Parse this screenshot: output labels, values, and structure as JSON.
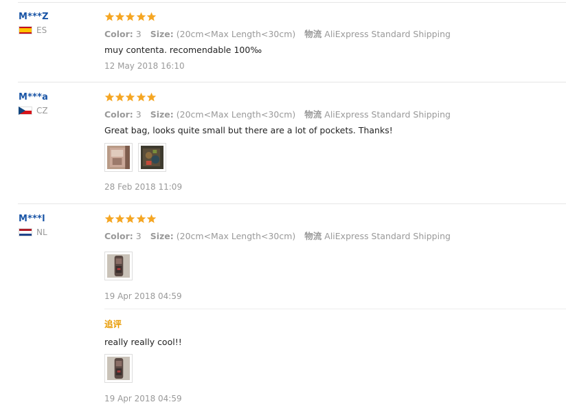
{
  "reviews": [
    {
      "user": "M***Z",
      "country": "ES",
      "flag": "spain-flag",
      "stars": 5,
      "color_label": "Color:",
      "color_value": "3",
      "size_label": "Size:",
      "size_value": "(20cm<Max Length<30cm)",
      "shipping_label": "物流",
      "shipping_value": "AliExpress Standard Shipping",
      "text": "muy contenta. recomendable 100‰",
      "date": "12 May 2018 16:10"
    },
    {
      "user": "M***a",
      "country": "CZ",
      "flag": "czech-flag",
      "stars": 5,
      "color_label": "Color:",
      "color_value": "3",
      "size_label": "Size:",
      "size_value": "(20cm<Max Length<30cm)",
      "shipping_label": "物流",
      "shipping_value": "AliExpress Standard Shipping",
      "text": "Great bag, looks quite small but there are a lot of pockets. Thanks!",
      "date": "28 Feb 2018 11:09"
    },
    {
      "user": "M***l",
      "country": "NL",
      "flag": "netherlands-flag",
      "stars": 5,
      "color_label": "Color:",
      "color_value": "3",
      "size_label": "Size:",
      "size_value": "(20cm<Max Length<30cm)",
      "shipping_label": "物流",
      "shipping_value": "AliExpress Standard Shipping",
      "date": "19 Apr 2018 04:59",
      "additional": {
        "label": "追评",
        "text": "really really cool!!",
        "date": "19 Apr 2018 04:59"
      }
    }
  ],
  "colors": {
    "username": "#1a55a6",
    "star": "#f5a623",
    "additional_label": "#e89a00",
    "muted": "#999999"
  }
}
